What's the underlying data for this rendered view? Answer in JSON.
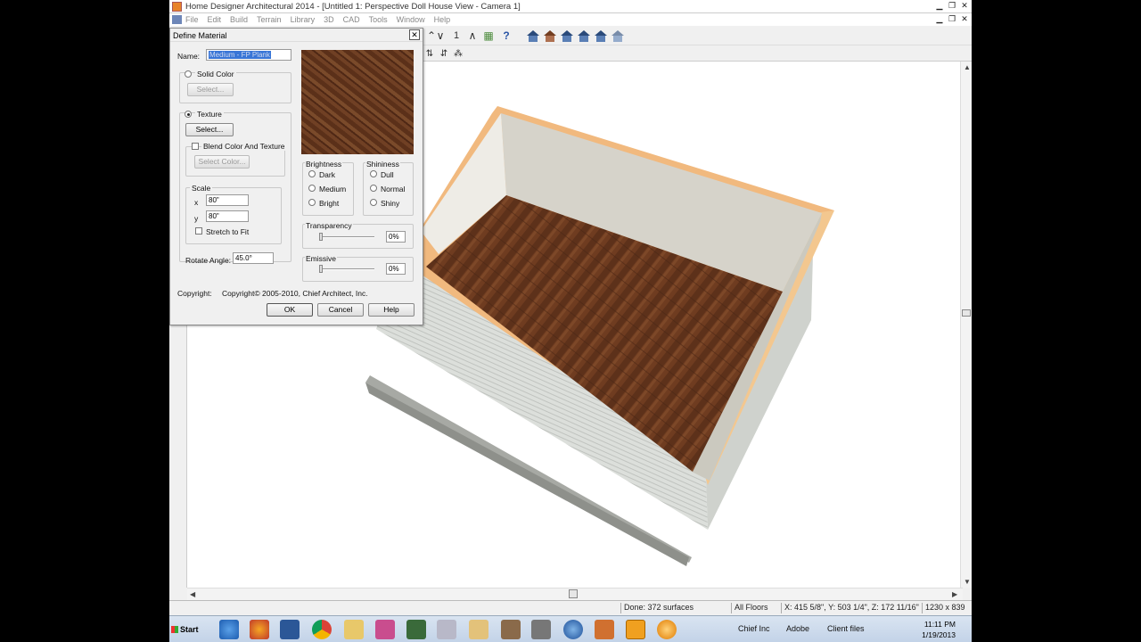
{
  "window": {
    "title": "Home Designer Architectural 2014 - [Untitled 1: Perspective Doll House View - Camera 1]"
  },
  "menu": [
    "File",
    "Edit",
    "Build",
    "Terrain",
    "Library",
    "3D",
    "CAD",
    "Tools",
    "Window",
    "Help"
  ],
  "toolbar": {
    "floor_number": "1"
  },
  "dialog": {
    "title": "Define Material",
    "name_label": "Name:",
    "name_value": "Medium - FP Plank",
    "solid_color_label": "Solid Color",
    "select_disabled": "Select...",
    "texture_label": "Texture",
    "select_texture": "Select...",
    "blend_label": "Blend Color And Texture",
    "select_color": "Select Color...",
    "scale_label": "Scale",
    "x_label": "x",
    "x_value": "80\"",
    "y_label": "y",
    "y_value": "80\"",
    "stretch_label": "Stretch to Fit",
    "rotate_label": "Rotate Angle:",
    "rotate_value": "45.0°",
    "brightness_label": "Brightness",
    "brightness_options": [
      "Dark",
      "Medium",
      "Bright"
    ],
    "shininess_label": "Shininess",
    "shininess_options": [
      "Dull",
      "Normal",
      "Shiny"
    ],
    "transparency_label": "Transparency",
    "transparency_value": "0%",
    "emissive_label": "Emissive",
    "emissive_value": "0%",
    "copyright_label": "Copyright:",
    "copyright_value": "Copyright© 2005-2010, Chief Architect, Inc.",
    "ok": "OK",
    "cancel": "Cancel",
    "help": "Help"
  },
  "status": {
    "done": "Done:  372 surfaces",
    "floors": "All Floors",
    "coords": "X: 415 5/8\", Y: 503 1/4\", Z: 172 11/16\"",
    "size": "1230 x 839"
  },
  "taskbar": {
    "start": "Start",
    "items": [
      "Chief Inc",
      "Adobe",
      "Client files"
    ],
    "time": "11:11 PM",
    "date": "1/19/2013"
  },
  "colors": {
    "wood": "#6b3a1e",
    "wall_top": "#f2b97a",
    "wall_inner": "#d8d5cc",
    "siding": "#d6d8d3",
    "selection": "#3875d7"
  }
}
